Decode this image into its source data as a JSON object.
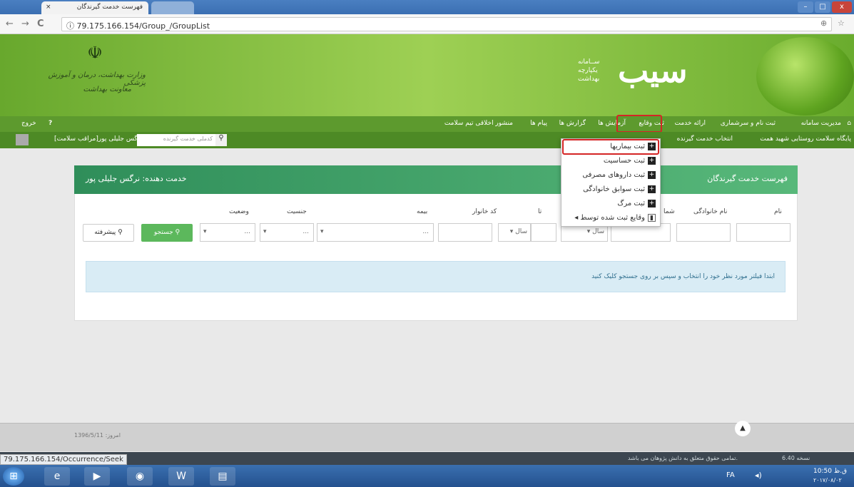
{
  "browser": {
    "tab_title": "فهرست خدمت گیرندگان",
    "tab_close": "×",
    "url": "79.175.166.154/Group_/GroupList",
    "status_url": "79.175.166.154/Occurrence/Seek",
    "back": "←",
    "forward": "→",
    "reload": "C",
    "info": "ⓘ"
  },
  "header": {
    "ministry_line1": "وزارت بهداشت، درمان و آموزش پزشکی",
    "ministry_line2": "معاونت بهداشت",
    "system_line1": "ســامانه",
    "system_line2": "یکپارچه",
    "system_line3": "بهداشت",
    "brand": "سیب"
  },
  "menu": {
    "items": [
      "مدیریت سامانه",
      "ثبت نام و سرشماری",
      "ارائه خدمت",
      "ثبت وقایع",
      "آزمایش ها",
      "گزارش ها",
      "پیام ها",
      "منشور اخلاقی تیم سلامت"
    ],
    "exit": "خروج",
    "help": "?"
  },
  "submenu": {
    "facility": "پایگاه سلامت روستایی شهید همت",
    "select_client": "انتخاب خدمت گیرنده",
    "search_placeholder": "کدملی خدمت گیرنده",
    "provider": "نرگس جلیلی پور[مراقب سلامت]"
  },
  "dropdown": {
    "items": [
      "ثبت بیماریها",
      "ثبت حساسیت",
      "ثبت داروهای مصرفی",
      "ثبت سوابق خانوادگی",
      "ثبت مرگ",
      "وقایع ثبت شده توسط"
    ]
  },
  "panel": {
    "title": "فهرست خدمت گیرندگان",
    "provider_label": "خدمت دهنده: نرگس جلیلی پور",
    "labels": {
      "name": "نام",
      "family": "نام خانوادگی",
      "national": "شما",
      "to": "تا",
      "family_code": "کد خانوار",
      "insurance": "بیمه",
      "gender": "جنسیت",
      "status": "وضعیت"
    },
    "year1": "سال",
    "year2": "سال",
    "ellipsis": "...",
    "search_button": "جستجو",
    "advanced_button": "پیشرفته",
    "info_text": "ابتدا فیلتر مورد نظر خود را انتخاب و سپس بر روی جستجو کلیک کنید"
  },
  "footer": {
    "date": "امروز: 1396/5/11",
    "version": "نسخه 6.40",
    "copyright": "تمامی حقوق متعلق به دانش پژوهان می باشد."
  },
  "taskbar": {
    "lang": "FA",
    "time": "10:50 ق.ظ",
    "date": "۲۰۱۷/۰۸/۰۲"
  }
}
